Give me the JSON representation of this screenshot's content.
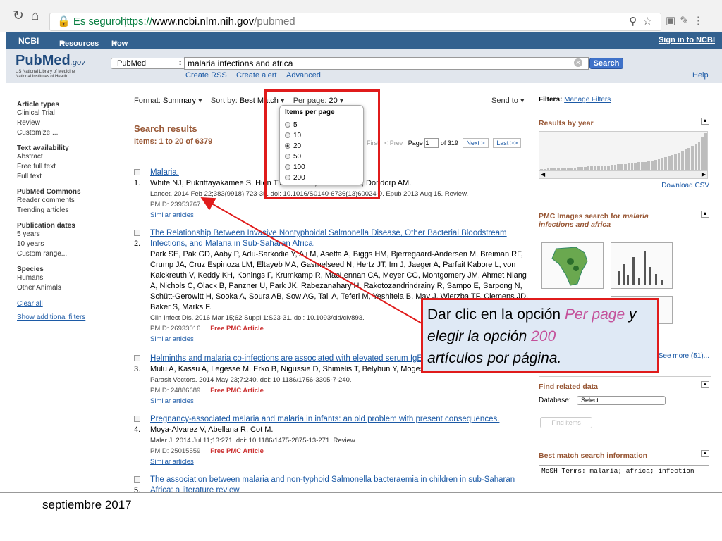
{
  "browser": {
    "secure_label": "Es seguro",
    "url_scheme": "https://",
    "url_host": "www.ncbi.nlm.nih.gov",
    "url_path": "/pubmed"
  },
  "ncbi": {
    "logo": "NCBI",
    "resources": "Resources",
    "howto": "How To",
    "signin": "Sign in to NCBI"
  },
  "header": {
    "logo_text": "PubMed",
    "logo_gov": ".gov",
    "logo_sub1": "US National Library of Medicine",
    "logo_sub2": "National Institutes of Health",
    "db_value": "PubMed",
    "search_value": "malaria infections and africa",
    "search_button": "Search",
    "create_rss": "Create RSS",
    "create_alert": "Create alert",
    "advanced": "Advanced",
    "help": "Help"
  },
  "sidebar": {
    "groups": [
      {
        "title": "Article types",
        "items": [
          "Clinical Trial",
          "Review",
          "Customize ..."
        ]
      },
      {
        "title": "Text availability",
        "items": [
          "Abstract",
          "Free full text",
          "Full text"
        ]
      },
      {
        "title": "PubMed Commons",
        "items": [
          "Reader comments",
          "Trending articles"
        ]
      },
      {
        "title": "Publication dates",
        "items": [
          "5 years",
          "10 years",
          "Custom range..."
        ]
      },
      {
        "title": "Species",
        "items": [
          "Humans",
          "Other Animals"
        ]
      }
    ],
    "clear_all": "Clear all",
    "show_filters": "Show additional filters"
  },
  "toolbar": {
    "format_label": "Format:",
    "format_value": "Summary",
    "sort_label": "Sort by:",
    "sort_value": "Best Match",
    "perpage_label": "Per page:",
    "perpage_value": "20",
    "send_to": "Send to"
  },
  "results_header": {
    "title": "Search results",
    "items": "Items: 1 to 20 of 6379",
    "first": "First",
    "prev": "< Prev",
    "page_label": "Page",
    "page_value": "1",
    "of_pages": "of 319",
    "next": "Next >",
    "last": "Last >>"
  },
  "perpage_dropdown": {
    "heading": "Items per page",
    "options": [
      "5",
      "10",
      "20",
      "50",
      "100",
      "200"
    ],
    "selected": "20"
  },
  "results": [
    {
      "num": "1.",
      "title": "Malaria.",
      "authors": "White NJ, Pukrittayakamee S, Hien TT, Faiz MA, Mokuolu OA, Dondorp AM.",
      "journal": "Lancet. 2014 Feb 22;383(9918):723-35. doi: 10.1016/S0140-6736(13)60024-0. Epub 2013 Aug 15. Review.",
      "pmid": "PMID: 23953767",
      "free": "",
      "similar": "Similar articles"
    },
    {
      "num": "2.",
      "title": "The Relationship Between Invasive Nontyphoidal Salmonella Disease, Other Bacterial Bloodstream Infections, and Malaria in Sub-Saharan Africa.",
      "authors": "Park SE, Pak GD, Aaby P, Adu-Sarkodie Y, Ali M, Aseffa A, Biggs HM, Bjerregaard-Andersen M, Breiman RF, Crump JA, Cruz Espinoza LM, Eltayeb MA, Gasmelseed N, Hertz JT, Im J, Jaeger A, Parfait Kabore L, von Kalckreuth V, Keddy KH, Konings F, Krumkamp R, MacLennan CA, Meyer CG, Montgomery JM, Ahmet Niang A, Nichols C, Olack B, Panzner U, Park JK, Rabezanahary H, Rakotozandrindrainy R, Sampo E, Sarpong N, Schütt-Gerowitt H, Sooka A, Soura AB, Sow AG, Tall A, Teferi M, Yeshitela B, May J, Wierzba TF, Clemens JD, Baker S, Marks F.",
      "journal": "Clin Infect Dis. 2016 Mar 15;62 Suppl 1:S23-31. doi: 10.1093/cid/civ893.",
      "pmid": "PMID: 26933016",
      "free": "Free PMC Article",
      "similar": "Similar articles"
    },
    {
      "num": "3.",
      "title": "Helminths and malaria co-infections are associated with elevated serum IgE.",
      "authors": "Mulu A, Kassu A, Legesse M, Erko B, Nigussie D, Shimelis T, Belyhun Y, Moges F, Ota F, Elias D.",
      "journal": "Parasit Vectors. 2014 May 23;7:240. doi: 10.1186/1756-3305-7-240.",
      "pmid": "PMID: 24886689",
      "free": "Free PMC Article",
      "similar": "Similar articles"
    },
    {
      "num": "4.",
      "title": "Pregnancy-associated malaria and malaria in infants: an old problem with present consequences.",
      "authors": "Moya-Alvarez V, Abellana R, Cot M.",
      "journal": "Malar J. 2014 Jul 11;13:271. doi: 10.1186/1475-2875-13-271. Review.",
      "pmid": "PMID: 25015559",
      "free": "Free PMC Article",
      "similar": "Similar articles"
    },
    {
      "num": "5.",
      "title": "The association between malaria and non-typhoid Salmonella bacteraemia in children in sub-Saharan Africa: a literature review.",
      "authors": "",
      "journal": "",
      "pmid": "",
      "free": "",
      "similar": ""
    }
  ],
  "right": {
    "filters_label": "Filters:",
    "manage_filters": "Manage Filters",
    "results_by_year": "Results by year",
    "download_csv": "Download CSV",
    "pmc_images_title": "PMC Images search for",
    "pmc_images_query": "malaria infections and africa",
    "see_more": "See more (51)...",
    "find_related": "Find related data",
    "database_label": "Database:",
    "database_value": "Select",
    "find_items": "Find items",
    "best_match_title": "Best match search information",
    "mesh_terms": "MeSH Terms: malaria; africa; infection"
  },
  "histogram": [
    1,
    1,
    2,
    2,
    2,
    3,
    3,
    3,
    4,
    4,
    4,
    5,
    5,
    5,
    6,
    6,
    6,
    7,
    7,
    8,
    8,
    9,
    9,
    10,
    10,
    11,
    12,
    12,
    13,
    14,
    14,
    15,
    16,
    17,
    18,
    20,
    22,
    24,
    26,
    28,
    30,
    32,
    35,
    38,
    40,
    44,
    48,
    52,
    60,
    68
  ],
  "callout": {
    "p1": "Dar clic en la opción ",
    "h1": "Per page",
    "p2": " y elegir la opción ",
    "h2": "200",
    "p3": "artículos por página."
  },
  "footer": "septiembre 2017"
}
